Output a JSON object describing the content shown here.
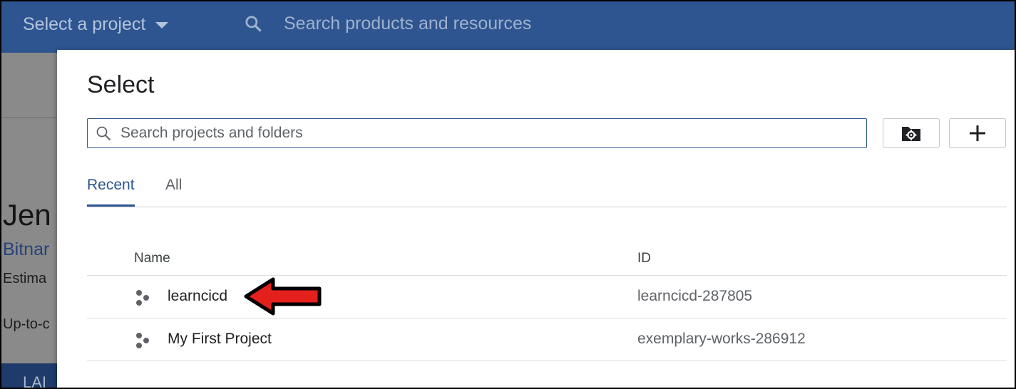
{
  "topbar": {
    "project_picker_label": "Select a project",
    "search_placeholder": "Search products and resources"
  },
  "background_page": {
    "title": "Jen",
    "link": "Bitnar",
    "estimate_text": "Estima",
    "uptodate_text": "Up-to-c",
    "button_label": "LAI"
  },
  "dialog": {
    "title": "Select",
    "search_placeholder": "Search projects and folders",
    "tabs": [
      {
        "label": "Recent",
        "active": true
      },
      {
        "label": "All",
        "active": false
      }
    ],
    "table": {
      "columns": [
        "Name",
        "ID"
      ],
      "rows": [
        {
          "name": "learncicd",
          "id": "learncicd-287805"
        },
        {
          "name": "My First Project",
          "id": "exemplary-works-286912"
        }
      ]
    }
  },
  "colors": {
    "topbar": "#2e5590",
    "accent": "#2e5590",
    "annotation_arrow": "#e3201b"
  },
  "icons": {
    "search": "search-icon",
    "caret": "caret-down-icon",
    "folder_settings": "folder-settings-icon",
    "add": "plus-icon",
    "project": "project-icon"
  }
}
